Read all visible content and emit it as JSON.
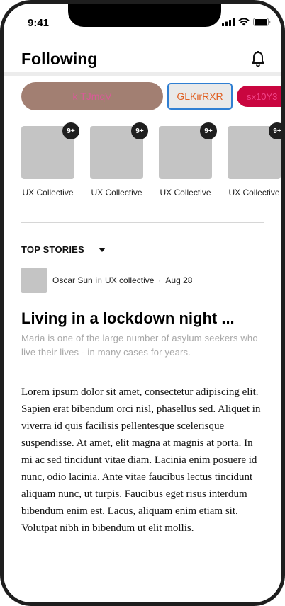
{
  "status_bar": {
    "time": "9:41"
  },
  "header": {
    "title": "Following"
  },
  "pills": [
    {
      "label": "k TJmqV"
    },
    {
      "label": "GLKirRXR"
    },
    {
      "label": "sx10Y3"
    }
  ],
  "publications": [
    {
      "badge": "9+",
      "name": "UX Collective"
    },
    {
      "badge": "9+",
      "name": "UX Collective"
    },
    {
      "badge": "9+",
      "name": "UX Collective"
    },
    {
      "badge": "9+",
      "name": "UX Collective"
    }
  ],
  "top_stories": {
    "label": "TOP STORIES",
    "author": "Oscar Sun",
    "in_word": "in",
    "publication": "UX collective",
    "separator": "·",
    "date": "Aug 28",
    "title": "Living in a lockdown night ...",
    "subtitle": "Maria is one of the large number of asylum seekers who live their lives - in many cases for years.",
    "body": "Lorem ipsum dolor sit amet, consectetur adipiscing elit. Sapien erat bibendum orci nisl, phasellus sed. Aliquet in viverra id quis facilisis pellentesque scelerisque suspendisse. At amet, elit magna at magnis at porta. In mi ac sed tincidunt vitae diam. Lacinia enim posuere id nunc, odio lacinia. Ante vitae faucibus lectus tincidunt aliquam nunc, ut turpis. Faucibus eget risus interdum bibendum enim est. Lacus, aliquam enim etiam sit. Volutpat nibh in bibendum ut elit mollis."
  },
  "icons": {
    "signal": "cellular-signal-icon",
    "wifi": "wifi-icon",
    "battery": "battery-icon",
    "bell": "notification-bell-icon",
    "caret": "caret-down-icon"
  },
  "colors": {
    "pill_1_bg": "#a27f72",
    "pill_1_text": "#d85b97",
    "pill_2_border": "#2f7fd3",
    "pill_2_text": "#e05f22",
    "pill_3_bg": "#c9063f",
    "pill_3_text": "#f2458a"
  }
}
